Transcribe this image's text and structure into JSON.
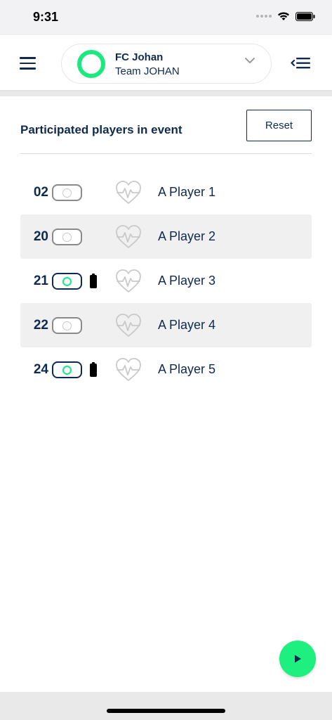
{
  "status_bar": {
    "time": "9:31",
    "icons": [
      "signal-dots-icon",
      "wifi-icon",
      "battery-icon"
    ]
  },
  "header": {
    "menu_icon": "hamburger-menu-icon",
    "team": {
      "name": "FC Johan",
      "subtitle": "Team JOHAN",
      "ring_color": "#1de880"
    },
    "chevron_icon": "chevron-down-icon",
    "side_menu_icon": "collapse-menu-icon"
  },
  "section": {
    "title": "Participated players in event",
    "reset_label": "Reset"
  },
  "players": [
    {
      "number": "02",
      "name": "A Player 1",
      "sensor_on": false,
      "battery": false,
      "highlight": false
    },
    {
      "number": "20",
      "name": "A Player 2",
      "sensor_on": false,
      "battery": false,
      "highlight": true
    },
    {
      "number": "21",
      "name": "A Player 3",
      "sensor_on": true,
      "battery": true,
      "highlight": false
    },
    {
      "number": "22",
      "name": "A Player 4",
      "sensor_on": false,
      "battery": false,
      "highlight": true
    },
    {
      "number": "24",
      "name": "A Player 5",
      "sensor_on": true,
      "battery": true,
      "highlight": false
    }
  ],
  "play_button": {
    "icon": "play-icon",
    "color": "#1ef07f"
  },
  "colors": {
    "accent": "#1de880",
    "primary_text": "#0f2a4f"
  }
}
